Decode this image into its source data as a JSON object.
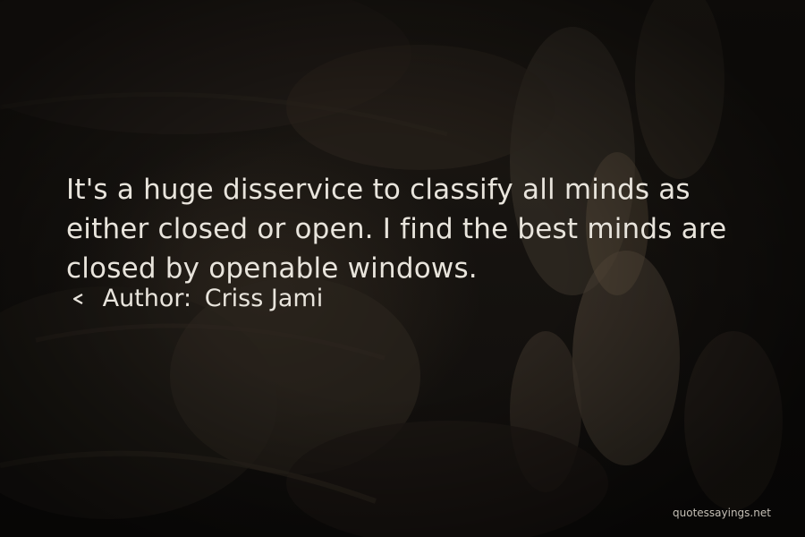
{
  "quote": {
    "lines": [
      "It's a huge disservice to classify all minds as",
      "either closed or open. I find the best minds are",
      "closed by openable windows."
    ]
  },
  "author": {
    "label": "Author:",
    "name": "Criss Jami"
  },
  "watermark": "quotessayings.net",
  "colors": {
    "text": "#e8e4dc",
    "background": "#14110e",
    "wood_end_grain": "#8a7a63"
  }
}
